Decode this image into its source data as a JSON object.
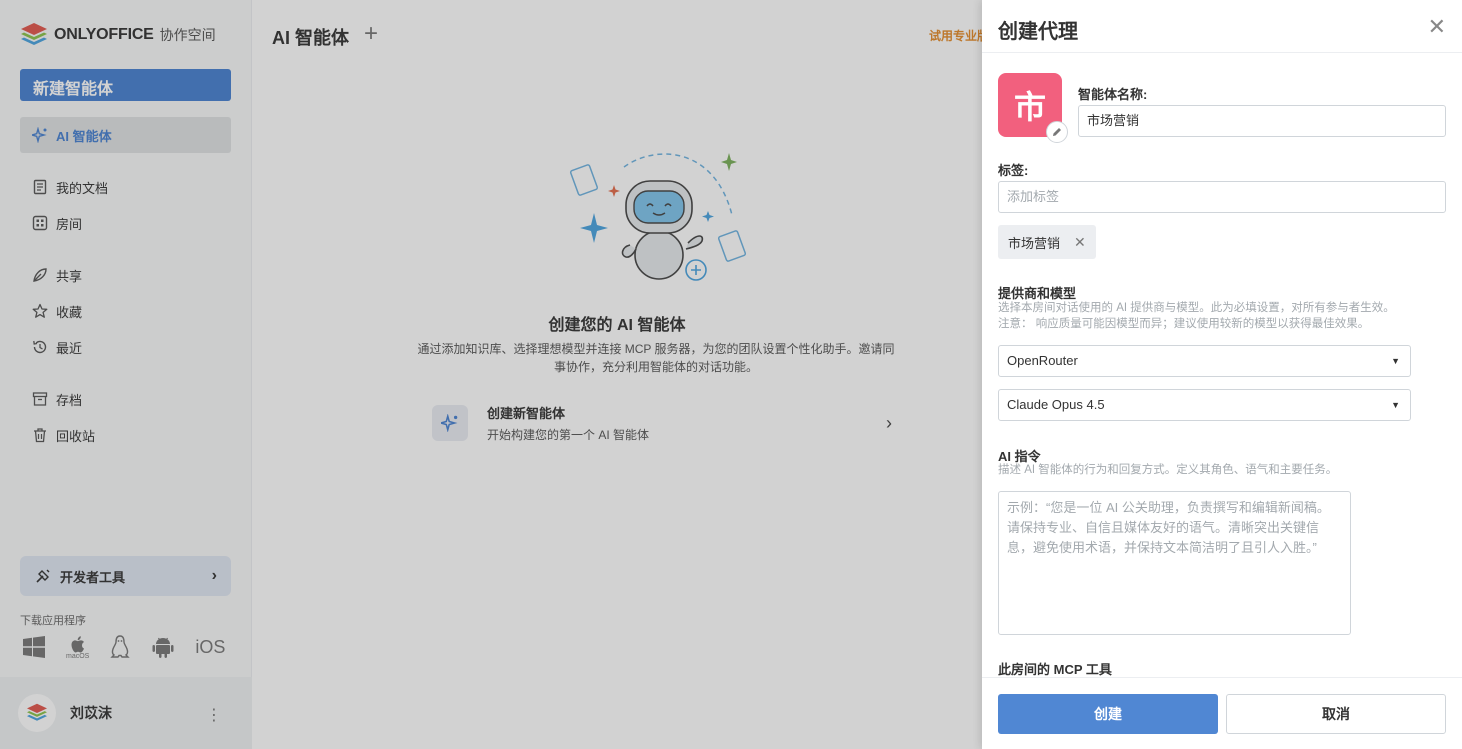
{
  "sidebar": {
    "logo_text": "ONLYOFFICE",
    "logo_sub": "协作空间",
    "new_button": "新建智能体",
    "items": [
      {
        "label": "AI 智能体",
        "icon": "ai-sparkle-icon",
        "active": true
      },
      {
        "label": "我的文档",
        "icon": "document-icon"
      },
      {
        "label": "房间",
        "icon": "rooms-icon"
      },
      {
        "label": "共享",
        "icon": "share-icon"
      },
      {
        "label": "收藏",
        "icon": "star-icon"
      },
      {
        "label": "最近",
        "icon": "history-icon"
      },
      {
        "label": "存档",
        "icon": "archive-icon"
      },
      {
        "label": "回收站",
        "icon": "trash-icon"
      }
    ],
    "dev_tools": "开发者工具",
    "download_label": "下载应用程序",
    "os": [
      "windows-icon",
      "macos-icon",
      "linux-icon",
      "android-icon",
      "ios-icon"
    ],
    "macos_label": "macOS",
    "ios_label": "iOS",
    "user_name": "刘苡沫"
  },
  "main": {
    "title": "AI 智能体",
    "try_pro": "试用专业版",
    "empty_title": "创建您的 AI 智能体",
    "empty_desc": "通过添加知识库、选择理想模型并连接 MCP 服务器，为您的团队设置个性化助手。邀请同事协作，充分利用智能体的对话功能。",
    "create_title": "创建新智能体",
    "create_sub": "开始构建您的第一个 AI 智能体"
  },
  "panel": {
    "title": "创建代理",
    "avatar_char": "市",
    "name_label": "智能体名称:",
    "name_value": "市场营销",
    "tags_label": "标签:",
    "tags_placeholder": "添加标签",
    "tag_chip": "市场营销",
    "provider_title": "提供商和模型",
    "provider_hint1": "选择本房间对话使用的 AI 提供商与模型。此为必填设置，对所有参与者生效。",
    "provider_hint2": "注意： 响应质量可能因模型而异；建议使用较新的模型以获得最佳效果。",
    "provider_value": "OpenRouter",
    "model_value": "Claude Opus 4.5",
    "instructions_title": "AI 指令",
    "instructions_hint": "描述 AI 智能体的行为和回复方式。定义其角色、语气和主要任务。",
    "instructions_placeholder": "示例：“您是一位 AI 公关助理，负责撰写和编辑新闻稿。请保持专业、自信且媒体友好的语气。清晰突出关键信息，避免使用术语，并保持文本简洁明了且引人入胜。”",
    "mcp_title": "此房间的 MCP 工具",
    "create_button": "创建",
    "cancel_button": "取消"
  }
}
